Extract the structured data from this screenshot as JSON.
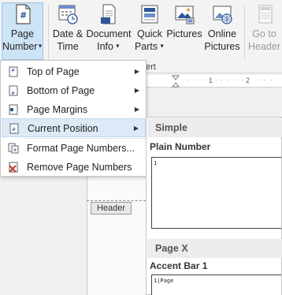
{
  "ribbon": {
    "page_number": {
      "line1": "Page",
      "line2": "Number"
    },
    "date_time": {
      "line1": "Date &",
      "line2": "Time"
    },
    "document_info": {
      "line1": "Document",
      "line2": "Info"
    },
    "quick_parts": {
      "line1": "Quick",
      "line2": "Parts"
    },
    "pictures": {
      "line1": "Pictures"
    },
    "online_pictures": {
      "line1": "Online",
      "line2": "Pictures"
    },
    "go_to_header": {
      "line1": "Go to",
      "line2": "Header"
    },
    "group_label_fragment": "ert"
  },
  "ruler": {
    "marks": [
      "1",
      "2"
    ]
  },
  "menu": {
    "items": [
      {
        "label": "Top of Page",
        "has_submenu": true
      },
      {
        "label": "Bottom of Page",
        "has_submenu": true
      },
      {
        "label": "Page Margins",
        "has_submenu": true
      },
      {
        "label": "Current Position",
        "has_submenu": true,
        "highlighted": true
      },
      {
        "label": "Format Page Numbers...",
        "has_submenu": false
      },
      {
        "label": "Remove Page Numbers",
        "has_submenu": false
      }
    ],
    "submenu_arrow": "▶"
  },
  "document": {
    "header_tag": "Header"
  },
  "gallery": {
    "sections": [
      {
        "name": "Simple",
        "items": [
          {
            "title": "Plain Number",
            "preview": "1"
          }
        ]
      },
      {
        "name": "Page X",
        "items": [
          {
            "title": "Accent Bar 1",
            "preview": "1|Page"
          }
        ]
      }
    ]
  },
  "colors": {
    "highlight": "#dde9f7",
    "active_button": "#cde3f6",
    "accent_blue": "#2b579a",
    "remove_red": "#c0392b"
  }
}
